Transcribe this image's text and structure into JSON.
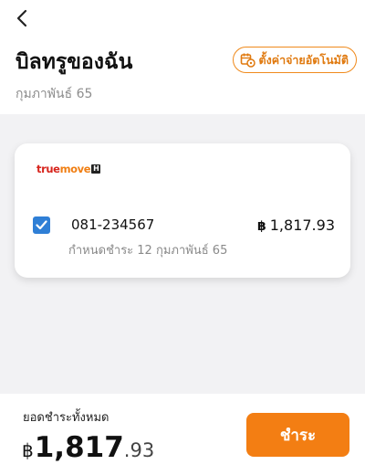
{
  "header": {
    "title": "บิลทรูของฉัน",
    "subtitle": "กุมภาพันธ์ 65",
    "back_icon": "chevron-left-icon",
    "autopay": {
      "label": "ตั้งค่าจ่ายอัตโนมัติ",
      "icon": "calendar-gear-icon"
    }
  },
  "bill": {
    "brand": {
      "true_text": "true",
      "move_text": "move",
      "h_text": "H"
    },
    "checked": true,
    "phone": "081-234567",
    "due_date": "กำหนดชำระ 12 กุมภาพันธ์ 65",
    "currency": "฿",
    "amount": "1,817.93"
  },
  "footer": {
    "total_label": "ยอดชำระทั้งหมด",
    "currency": "฿",
    "total_int": "1,817",
    "total_dec": ".93",
    "pay_label": "ชำระ"
  },
  "colors": {
    "accent": "#f37e13",
    "checkbox": "#2f7fd6",
    "background": "#f2f2f4"
  }
}
